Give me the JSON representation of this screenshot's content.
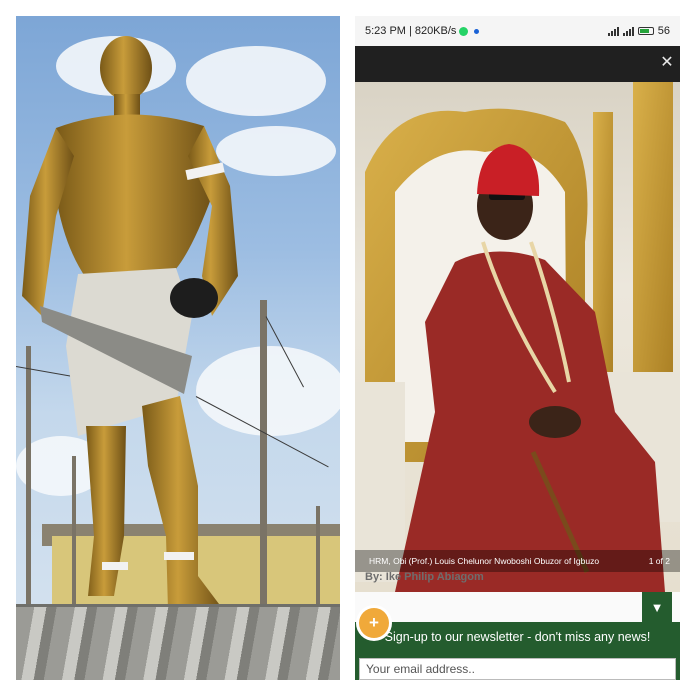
{
  "status_bar": {
    "time": "5:23 PM",
    "separator": "|",
    "speed": "820KB/s",
    "battery": "56"
  },
  "lightbox": {
    "close_icon": "close-icon",
    "caption": "HRM, Obi (Prof.) Louis Chelunor Nwoboshi Obuzor of Igbuzo",
    "counter": "1 of 2"
  },
  "article": {
    "byline": "By: Ike Philip Abiagom"
  },
  "newsletter": {
    "fab_icon": "+",
    "toggle_icon": "▼",
    "text": "Sign-up to our newsletter - don't miss any news!",
    "email_placeholder": "Your email address.."
  },
  "colors": {
    "newsletter_green": "#245c2e",
    "fab_orange": "#f0a93a",
    "statue_gold": "#b8912e",
    "robe_red": "#9a2a26"
  }
}
